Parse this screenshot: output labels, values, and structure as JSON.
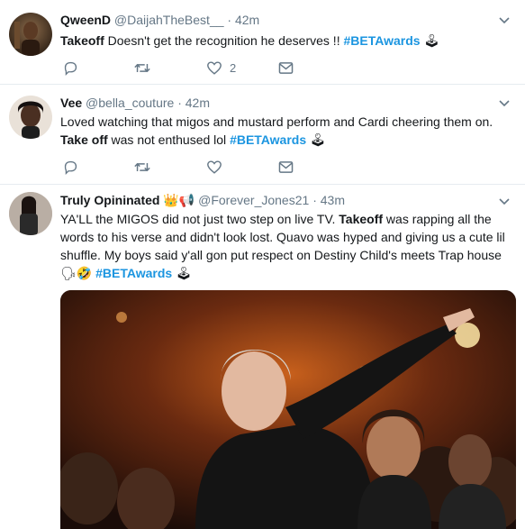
{
  "tweets": [
    {
      "name": "QweenD",
      "handle": "@DaijahTheBest__",
      "dot": "·",
      "time": "42m",
      "text": [
        {
          "t": "Takeoff",
          "bold": true
        },
        {
          "t": " Doesn't get the recognition he deserves !! "
        },
        {
          "t": "#BETAwards",
          "tag": true
        },
        {
          "t": " 🕹"
        }
      ],
      "likes": "2"
    },
    {
      "name": "Vee",
      "handle": "@bella_couture",
      "dot": "·",
      "time": "42m",
      "text": [
        {
          "t": "Loved watching that migos and mustard perform and Cardi cheering them on. "
        },
        {
          "t": "Take off",
          "bold": true
        },
        {
          "t": " was not enthused lol "
        },
        {
          "t": "#BETAwards",
          "tag": true
        },
        {
          "t": " 🕹"
        }
      ],
      "likes": ""
    },
    {
      "name": "Truly Opininated",
      "name_emoji": "👑📢",
      "handle": "@Forever_Jones21",
      "dot": "·",
      "time": "43m",
      "text": [
        {
          "t": "YA'LL the MIGOS did not just two step on live TV. "
        },
        {
          "t": "Takeoff",
          "bold": true
        },
        {
          "t": " was rapping all the words to his verse and didn't look lost. Quavo was hyped and giving us a cute lil shuffle. My boys said y'all gon put respect on Destiny Child's meets Trap house 🗣🤣 "
        },
        {
          "t": "#BETAwards",
          "tag": true
        },
        {
          "t": " 🕹"
        }
      ],
      "likes": ""
    }
  ],
  "icons": {
    "reply": "reply-icon",
    "retweet": "retweet-icon",
    "like": "heart-icon",
    "message": "direct-message-icon",
    "menu": "chevron-down-icon"
  },
  "colors": {
    "hashtag": "#1b95e0",
    "secondary": "#657786",
    "border": "#e6ecf0"
  }
}
